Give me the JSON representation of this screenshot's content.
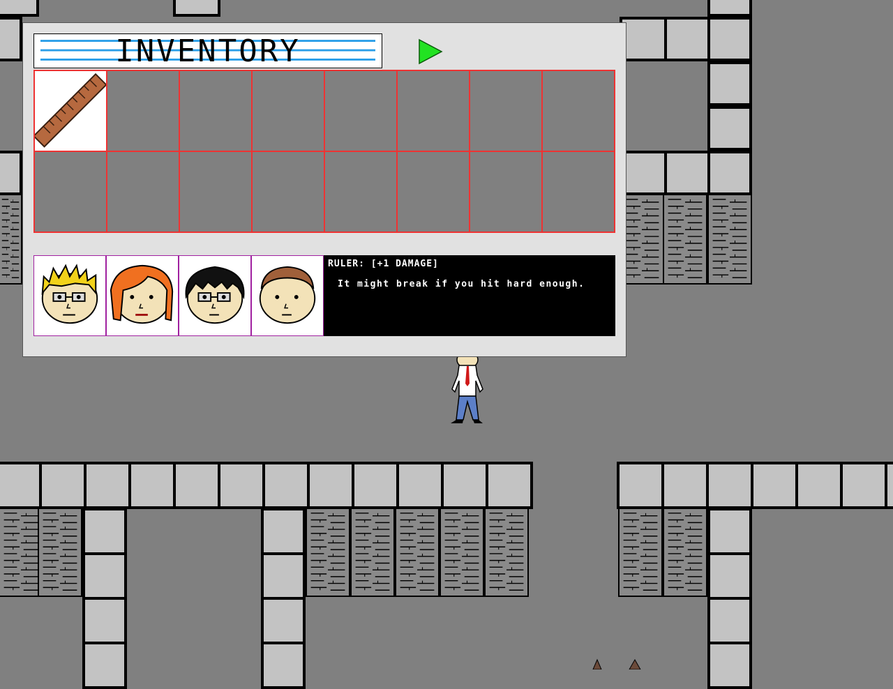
{
  "inventory": {
    "title": "INVENTORY",
    "play_icon": "green-play-triangle",
    "slots": [
      {
        "item": "ruler",
        "icon": "ruler-icon"
      },
      {
        "item": ""
      },
      {
        "item": ""
      },
      {
        "item": ""
      },
      {
        "item": ""
      },
      {
        "item": ""
      },
      {
        "item": ""
      },
      {
        "item": ""
      },
      {
        "item": ""
      },
      {
        "item": ""
      },
      {
        "item": ""
      },
      {
        "item": ""
      },
      {
        "item": ""
      },
      {
        "item": ""
      },
      {
        "item": ""
      },
      {
        "item": ""
      }
    ],
    "party": [
      {
        "hair": "blond-spiky",
        "glasses": true
      },
      {
        "hair": "orange-long",
        "glasses": false
      },
      {
        "hair": "black",
        "glasses": true
      },
      {
        "hair": "brown-short",
        "glasses": false
      }
    ],
    "description": {
      "title": "RULER: [+1 DAMAGE]",
      "body": "It might break if you hit hard enough."
    }
  },
  "colors": {
    "floor": "#808080",
    "wall_block": "#c3c3c3",
    "slot_border": "#e33333",
    "portrait_border": "#a020a0",
    "play_green": "#22e222"
  }
}
